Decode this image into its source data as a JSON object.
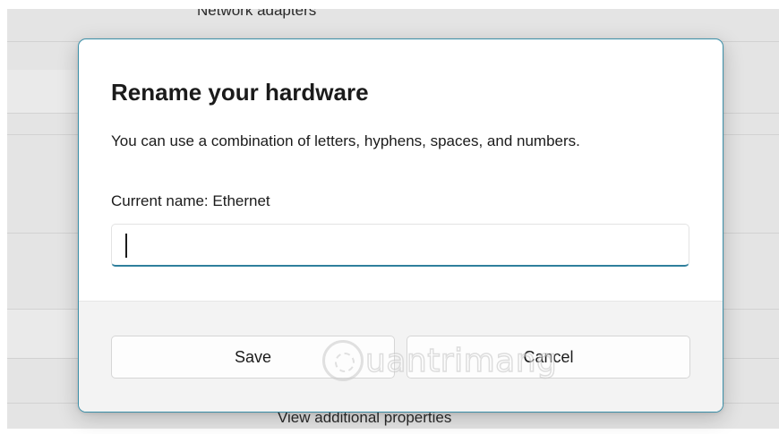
{
  "background": {
    "page_title": "Network adapters",
    "footer_link": "View additional properties"
  },
  "dialog": {
    "title": "Rename your hardware",
    "description": "You can use a combination of letters, hyphens, spaces, and numbers.",
    "current_name_label": "Current name: Ethernet",
    "input_value": "",
    "save_label": "Save",
    "cancel_label": "Cancel",
    "accent_color": "#2f7f9c"
  },
  "watermark": {
    "text": "uantrimang"
  }
}
